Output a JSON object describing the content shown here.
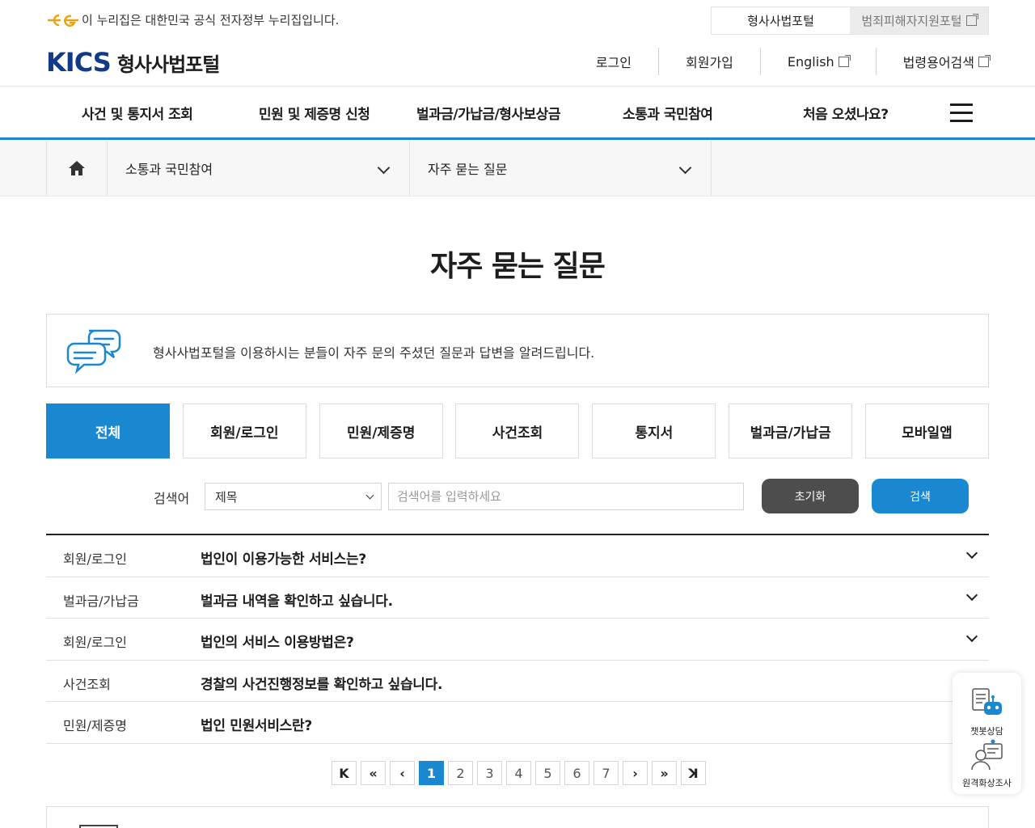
{
  "topbar": {
    "gov_notice": "이 누리집은 대한민국 공식 전자정부 누리집입니다.",
    "portal_current": "형사사법포털",
    "portal_other": "범죄피해자지원포털"
  },
  "header": {
    "logo_mark": "KICS",
    "site_name": "형사사법포털",
    "util": {
      "login": "로그인",
      "signup": "회원가입",
      "english": "English",
      "legal_terms": "법령용어검색"
    }
  },
  "gnb": {
    "items": [
      "사건 및 통지서 조회",
      "민원 및 제증명 신청",
      "벌과금/가납금/형사보상금",
      "소통과 국민참여",
      "처음 오셨나요?"
    ]
  },
  "breadcrumb": {
    "level1": "소통과 국민참여",
    "level2": "자주 묻는 질문"
  },
  "page": {
    "title": "자주 묻는 질문",
    "intro": "형사사법포털을 이용하시는 분들이 자주 문의 주셨던 질문과 답변을 알려드립니다."
  },
  "tabs": [
    "전체",
    "회원/로그인",
    "민원/제증명",
    "사건조회",
    "통지서",
    "벌과금/가납금",
    "모바일앱"
  ],
  "search": {
    "label": "검색어",
    "field_selected": "제목",
    "placeholder": "검색어를 입력하세요",
    "reset_label": "초기화",
    "search_label": "검색"
  },
  "faq": [
    {
      "category": "회원/로그인",
      "question": "법인이 이용가능한 서비스는?"
    },
    {
      "category": "벌과금/가납금",
      "question": "벌과금 내역을 확인하고 싶습니다."
    },
    {
      "category": "회원/로그인",
      "question": "법인의 서비스 이용방법은?"
    },
    {
      "category": "사건조회",
      "question": "경찰의 사건진행정보를 확인하고 싶습니다."
    },
    {
      "category": "민원/제증명",
      "question": "법인 민원서비스란?"
    }
  ],
  "pagination": {
    "first": "K",
    "prev_block": "«",
    "prev": "‹",
    "pages": [
      "1",
      "2",
      "3",
      "4",
      "5",
      "6",
      "7"
    ],
    "current": "1",
    "next": "›",
    "next_block": "»",
    "last": "ꓘ"
  },
  "quick_menu": {
    "chatbot": "챗봇상담",
    "video": "원격화상조사"
  },
  "colors": {
    "accent": "#1a88d0",
    "brand_navy": "#123a87",
    "reset_button": "#4d4d4d"
  }
}
